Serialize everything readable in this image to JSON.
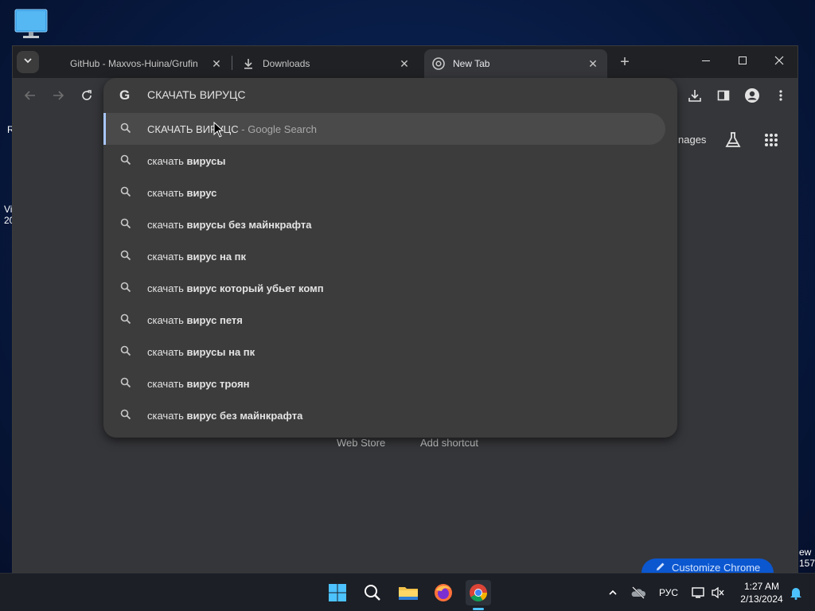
{
  "desktop": {
    "edge_texts": [
      "R",
      "Vi",
      "20",
      "ew",
      "157"
    ]
  },
  "browser": {
    "tabs": [
      {
        "title": "GitHub - Maxvos-Huina/Grufin",
        "active": false
      },
      {
        "title": "Downloads",
        "active": false
      },
      {
        "title": "New Tab",
        "active": true
      }
    ],
    "new_tab_label": "+",
    "window_controls": [
      "minimize",
      "maximize",
      "close"
    ]
  },
  "omnibox": {
    "value": "СКАЧАТЬ ВИРУЦС",
    "suggestions": [
      {
        "typed": "СКАЧАТЬ ВИРУЦС",
        "bold": "",
        "desc": " - Google Search",
        "selected": true
      },
      {
        "typed": "скачать ",
        "bold": "вирусы",
        "desc": "",
        "selected": false
      },
      {
        "typed": "скачать ",
        "bold": "вирус",
        "desc": "",
        "selected": false
      },
      {
        "typed": "скачать ",
        "bold": "вирусы без майнкрафта",
        "desc": "",
        "selected": false
      },
      {
        "typed": "скачать ",
        "bold": "вирус на пк",
        "desc": "",
        "selected": false
      },
      {
        "typed": "скачать ",
        "bold": "вирус который убьет комп",
        "desc": "",
        "selected": false
      },
      {
        "typed": "скачать ",
        "bold": "вирус петя",
        "desc": "",
        "selected": false
      },
      {
        "typed": "скачать ",
        "bold": "вирусы на пк",
        "desc": "",
        "selected": false
      },
      {
        "typed": "скачать ",
        "bold": "вирус троян",
        "desc": "",
        "selected": false
      },
      {
        "typed": "скачать ",
        "bold": "вирус без майнкрафта",
        "desc": "",
        "selected": false
      }
    ]
  },
  "ntp": {
    "images_link": "nages",
    "web_store": "Web Store",
    "add_shortcut": "Add shortcut",
    "customize": "Customize Chrome"
  },
  "taskbar": {
    "language": "РУС",
    "time": "1:27 AM",
    "date": "2/13/2024"
  },
  "colors": {
    "accent": "#a8c7fa",
    "customize_bg": "#0b57d0",
    "selected_row": "#4a4a4a",
    "popup_bg": "#3c3c3c"
  }
}
